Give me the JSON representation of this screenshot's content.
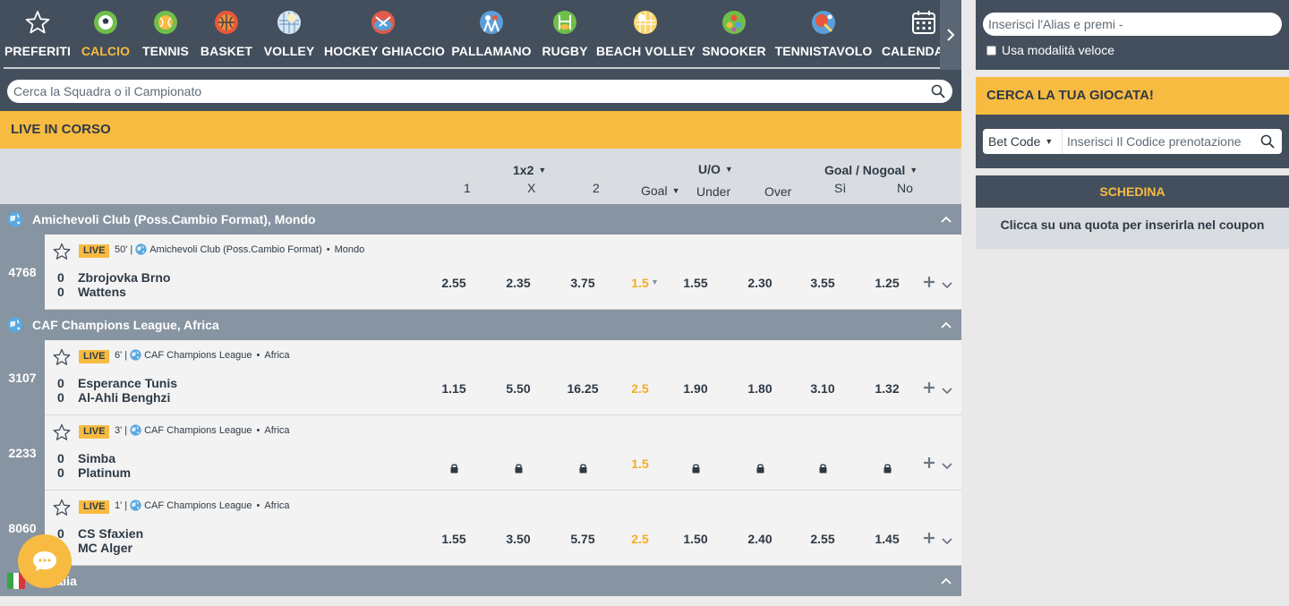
{
  "sports": [
    {
      "label": "PREFERITI",
      "icon": "star-icon",
      "active": false
    },
    {
      "label": "CALCIO",
      "icon": "soccer-ball-icon",
      "active": true
    },
    {
      "label": "TENNIS",
      "icon": "tennis-ball-icon",
      "active": false
    },
    {
      "label": "BASKET",
      "icon": "basketball-icon",
      "active": false
    },
    {
      "label": "VOLLEY",
      "icon": "volleyball-icon",
      "active": false
    },
    {
      "label": "HOCKEY GHIACCIO",
      "icon": "ice-hockey-icon",
      "active": false
    },
    {
      "label": "PALLAMANO",
      "icon": "handball-icon",
      "active": false
    },
    {
      "label": "RUGBY",
      "icon": "rugby-icon",
      "active": false
    },
    {
      "label": "BEACH VOLLEY",
      "icon": "beach-volley-icon",
      "active": false
    },
    {
      "label": "SNOOKER",
      "icon": "snooker-icon",
      "active": false
    },
    {
      "label": "TENNISTAVOLO",
      "icon": "table-tennis-icon",
      "active": false
    },
    {
      "label": "CALENDARIO",
      "icon": "calendar-icon",
      "active": false
    }
  ],
  "search": {
    "placeholder": "Cerca la Squadra o il Campionato"
  },
  "live_header": "LIVE IN CORSO",
  "columns": {
    "group_1x2": "1x2",
    "group_uo": "U/O",
    "group_goal": "Goal / Nogoal",
    "c1": "1",
    "cx": "X",
    "c2": "2",
    "goal": "Goal",
    "under": "Under",
    "over": "Over",
    "si": "Sì",
    "no": "No"
  },
  "leagues": [
    {
      "name": "Amichevoli Club (Poss.Cambio Format), Mondo",
      "matches": [
        {
          "id": "4768",
          "minute": "50'",
          "competition": "Amichevoli Club (Poss.Cambio Format)",
          "region": "Mondo",
          "home": "Zbrojovka Brno",
          "away": "Wattens",
          "home_score": "0",
          "away_score": "0",
          "odds": [
            "2.55",
            "2.35",
            "3.75",
            "1.5",
            "1.55",
            "2.30",
            "3.55",
            "1.25"
          ],
          "locked": false
        }
      ]
    },
    {
      "name": "CAF Champions League, Africa",
      "matches": [
        {
          "id": "3107",
          "minute": "6'",
          "competition": "CAF Champions League",
          "region": "Africa",
          "home": "Esperance Tunis",
          "away": "Al-Ahli Benghzi",
          "home_score": "0",
          "away_score": "0",
          "odds": [
            "1.15",
            "5.50",
            "16.25",
            "2.5",
            "1.90",
            "1.80",
            "3.10",
            "1.32"
          ],
          "locked": false
        },
        {
          "id": "2233",
          "minute": "3'",
          "competition": "CAF Champions League",
          "region": "Africa",
          "home": "Simba",
          "away": "Platinum",
          "home_score": "0",
          "away_score": "0",
          "odds": [
            "",
            "",
            "",
            "1.5",
            "",
            "",
            "",
            ""
          ],
          "locked": true
        },
        {
          "id": "8060",
          "minute": "1'",
          "competition": "CAF Champions League",
          "region": "Africa",
          "home": "CS Sfaxien",
          "away": "MC Alger",
          "home_score": "0",
          "away_score": "0",
          "odds": [
            "1.55",
            "3.50",
            "5.75",
            "2.5",
            "1.50",
            "2.40",
            "2.55",
            "1.45"
          ],
          "locked": false
        }
      ]
    },
    {
      "name": "A, Italia",
      "matches": []
    }
  ],
  "live_label": "LIVE",
  "sidebar": {
    "login_placeholder": "Inserisci l'Alias e premi -",
    "fast_mode": "Usa modalità veloce",
    "find_bet_title": "CERCA LA TUA GIOCATA!",
    "bet_code_select": "Bet Code",
    "bet_code_placeholder": "Inserisci Il Codice prenotazione",
    "coupon_title": "SCHEDINA",
    "coupon_empty": "Clicca su una quota per inserirla nel coupon"
  },
  "colors": {
    "accent": "#f8bb41",
    "nav": "#434f5c",
    "league": "#8794a1",
    "line_odd": "#f4ac22"
  }
}
